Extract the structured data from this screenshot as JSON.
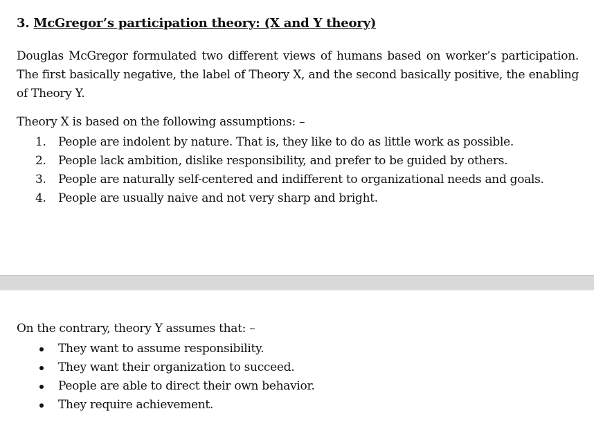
{
  "previous_page_cut_text": "",
  "section": {
    "number": "3.",
    "title": "McGregor’s participation theory: (X and Y theory)"
  },
  "intro_paragraph": "Douglas McGregor formulated two different views of humans based on worker’s participation. The first basically negative, the label of Theory X, and the second basically positive, the enabling of Theory Y.",
  "theory_x": {
    "intro": "Theory X is based on the following assumptions: –",
    "items": [
      {
        "marker": "1.",
        "text": "People are indolent by nature. That is, they like to do as little work as possible."
      },
      {
        "marker": "2.",
        "text": "People lack ambition, dislike responsibility, and prefer to be guided by others."
      },
      {
        "marker": "3.",
        "text": "People are naturally self-centered and indifferent to organizational needs and goals."
      },
      {
        "marker": "4.",
        "text": "People are usually naive and not very sharp and bright."
      }
    ]
  },
  "theory_y": {
    "intro": "On the contrary, theory Y assumes that: –",
    "items": [
      {
        "text": "They want to assume responsibility."
      },
      {
        "text": "They want their organization to succeed."
      },
      {
        "text": "People are able to direct their own behavior."
      },
      {
        "text": "They require achievement."
      }
    ]
  }
}
